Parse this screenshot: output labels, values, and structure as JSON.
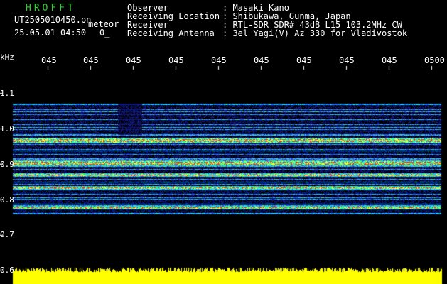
{
  "header": {
    "brand": "HROFFT",
    "filename": "UT2505010450.pn",
    "mode": "meteor",
    "datetime": "25.05.01 04:50",
    "extra": "0_",
    "fields": [
      {
        "label": "Observer",
        "value": ": Masaki Kano"
      },
      {
        "label": "Receiving Location",
        "value": ": Shibukawa, Gunma, Japan"
      },
      {
        "label": "Receiver",
        "value": ": RTL-SDR SDR# 43dB L15 103.2MHz CW"
      },
      {
        "label": "Receiving Antenna",
        "value": ": 3el Yagi(V) Az 330 for Vladivostok"
      }
    ]
  },
  "axis": {
    "unit": "kHz",
    "y_ticks": [
      "1.1",
      "1.0",
      "0.9",
      "0.8",
      "0.7",
      "0.6"
    ],
    "x_ticks": [
      "045",
      "045",
      "045",
      "045",
      "045",
      "045",
      "045",
      "045",
      "045",
      "0500"
    ]
  },
  "colors": {
    "background": "#000000",
    "label_green": "#2bd12b",
    "signal_red": "#ff2020",
    "noise_blue": "#1030ff",
    "level_yellow": "#ffff00"
  }
}
